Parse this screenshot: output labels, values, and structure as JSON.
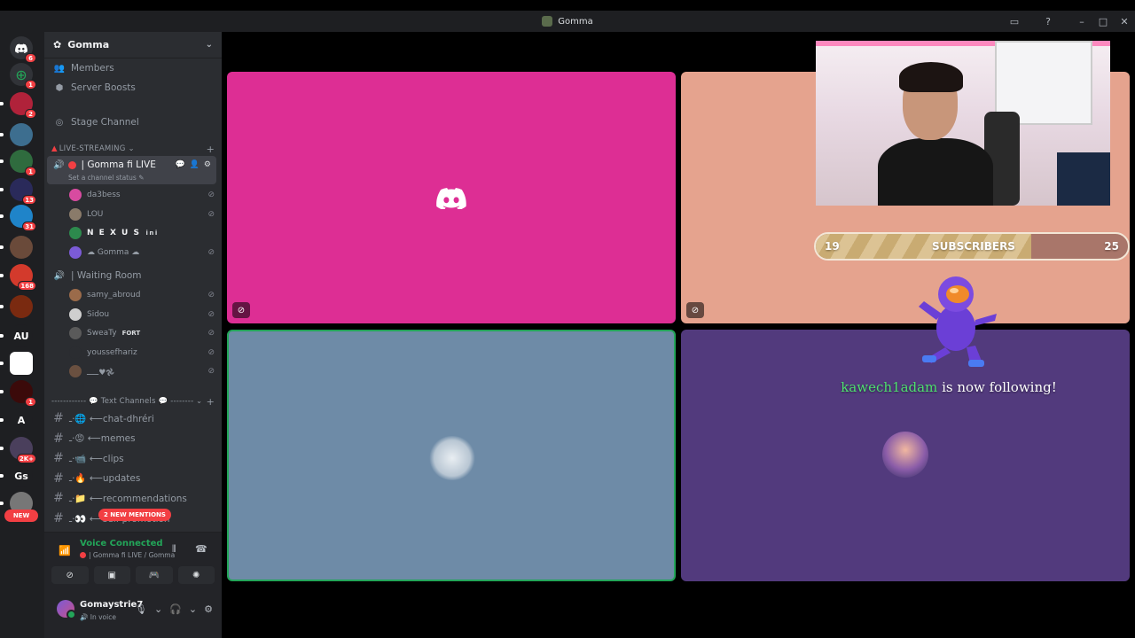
{
  "window": {
    "title": "Gomma",
    "controls": [
      "screen-share-icon",
      "help-icon",
      "minimize-icon",
      "maximize-icon",
      "close-icon"
    ]
  },
  "rail": {
    "home_badge": "6",
    "add_badge": "1",
    "servers": [
      {
        "icon": "server-1",
        "badge": "2",
        "color": "#b0223a"
      },
      {
        "icon": "server-2",
        "badge": "",
        "color": "#3d6e8f"
      },
      {
        "icon": "server-3",
        "badge": "1",
        "color": "#2f6b3e"
      },
      {
        "icon": "server-4",
        "badge": "13",
        "color": "#2a2a5a"
      },
      {
        "icon": "server-5",
        "badge": "31",
        "color": "#1f84c9"
      },
      {
        "icon": "server-6",
        "badge": "",
        "color": "#6a4a3a"
      },
      {
        "icon": "server-7",
        "badge": "168",
        "color": "#d33a2c"
      },
      {
        "icon": "server-8",
        "badge": "",
        "color": "#7a2a10"
      },
      {
        "icon": "server-au",
        "label": "AU",
        "badge": "",
        "color": "#1e1f22"
      },
      {
        "icon": "server-tu",
        "badge": "",
        "color": "#ffffff"
      },
      {
        "icon": "server-blood",
        "badge": "1",
        "color": "#3b0a0a"
      },
      {
        "icon": "server-a",
        "label": "A",
        "badge": "",
        "color": "#1e1f22"
      },
      {
        "icon": "server-9",
        "badge": "2K+",
        "color": "#4a3f5c"
      },
      {
        "icon": "server-gs",
        "label": "Gs",
        "badge": "",
        "color": "#1e1f22"
      },
      {
        "icon": "server-10",
        "badge": "",
        "color": "#777777"
      }
    ],
    "new_label": "NEW"
  },
  "sidebar": {
    "server_name": "Gomma",
    "menu": [
      {
        "icon": "members-icon",
        "label": "Members"
      },
      {
        "icon": "boost-icon",
        "label": "Server Boosts"
      }
    ],
    "stage_channel": "Stage Channel",
    "category_live": "LIVE-STREAMING",
    "active_channel": {
      "name": "| Gomma fi LIVE",
      "status": "Set a channel status"
    },
    "live_members": [
      {
        "name": "da3bess",
        "color": "#d84ba0"
      },
      {
        "name": "LOU",
        "color": "#8a7b6a"
      },
      {
        "name": "N E X U S",
        "tag": "ini",
        "color": "#2d8a4d",
        "bold": true
      },
      {
        "name": "☁ Gomma ☁",
        "color": "#7b5bd6"
      }
    ],
    "waiting_room": "| Waiting Room",
    "waiting_members": [
      {
        "name": "samy_abroud",
        "color": "#9b6b4a"
      },
      {
        "name": "Sidou",
        "color": "#cfcfcf"
      },
      {
        "name": "SweaTy",
        "tag": "FORT",
        "color": "#5a5a5a"
      },
      {
        "name": "youssefhariz",
        "color": "#2b2d31"
      },
      {
        "name": "ـــــ♥︎𖣘",
        "color": "#6a5040"
      }
    ],
    "text_category": "------------ 💬 Text Channels 💬 ---------",
    "text_channels": [
      "ـ·🌐 ⟵chat-dhréri",
      "ـ·😡 ⟵memes",
      "ـ·📹 ⟵clips",
      "ـ·🔥 ⟵updates",
      "ـ·📁 ⟵recommendations",
      "ـ·👀 ⟵self-promotion"
    ],
    "new_mentions": "2 NEW MENTIONS"
  },
  "voice_panel": {
    "title": "Voice Connected",
    "channel": "| Gomma fi LIVE / Gomma"
  },
  "user_panel": {
    "username": "Gomaystrie7",
    "status": "In voice"
  },
  "overlay": {
    "subscribers_current": "19",
    "subscribers_label": "SUBSCRIBERS",
    "subscribers_goal": "25",
    "progress_fraction": 0.69,
    "alert_user": "kawech1adam",
    "alert_text": " is now following!"
  },
  "colors": {
    "discord_tile": "#dd2e94",
    "stream_tile": "#e5a38e",
    "speaking_border": "#23a559",
    "purple_tile": "#523a7d"
  }
}
